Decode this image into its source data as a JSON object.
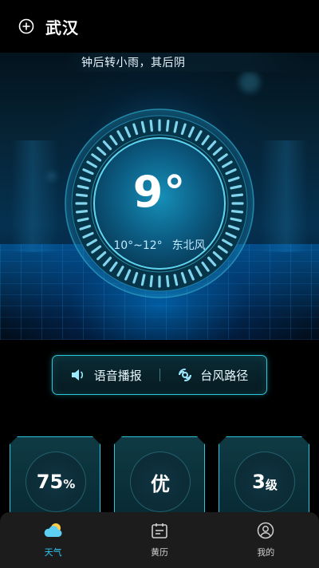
{
  "header": {
    "city": "武汉",
    "add_icon": "add-circle-icon"
  },
  "marquee": {
    "text": "钟后转小雨，其后阴"
  },
  "weather": {
    "temperature": "9°",
    "range": "10°~12°",
    "wind": "东北风"
  },
  "actions": {
    "voice": {
      "label": "语音播报",
      "icon": "speaker-icon"
    },
    "typhoon": {
      "label": "台风路径",
      "icon": "typhoon-icon"
    }
  },
  "stats": [
    {
      "value": "75",
      "unit": "%"
    },
    {
      "value": "优",
      "unit": ""
    },
    {
      "value": "3",
      "unit": "级"
    }
  ],
  "tabs": [
    {
      "label": "天气",
      "icon": "cloud-weather-icon",
      "active": true
    },
    {
      "label": "黄历",
      "icon": "calendar-icon",
      "active": false
    },
    {
      "label": "我的",
      "icon": "user-icon",
      "active": false
    }
  ],
  "colors": {
    "accent": "#2bc6d9",
    "tab_active": "#2fc6f0",
    "tabbar_bg": "#1c1c1c",
    "card_bg": "#0b3038"
  }
}
